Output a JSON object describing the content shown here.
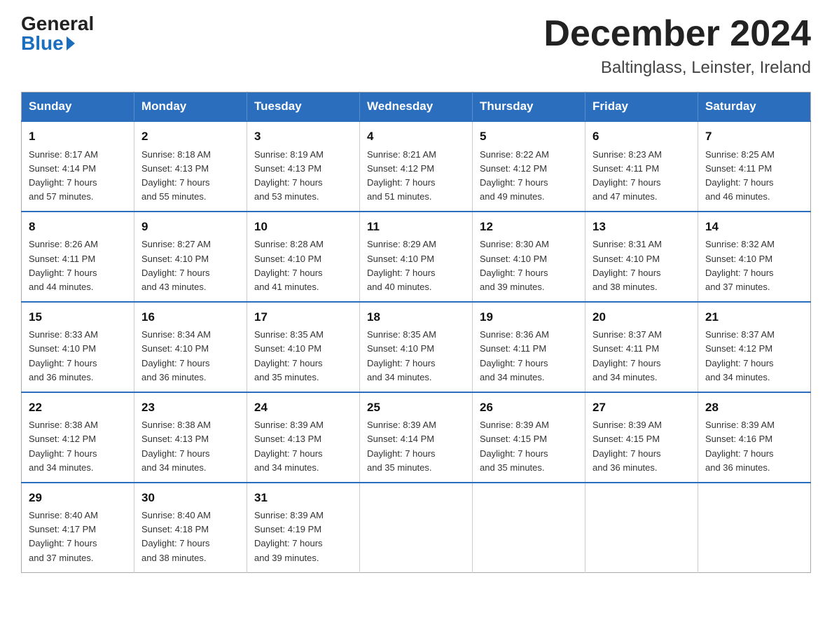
{
  "logo": {
    "general": "General",
    "blue": "Blue"
  },
  "title": {
    "month": "December 2024",
    "location": "Baltinglass, Leinster, Ireland"
  },
  "days_of_week": [
    "Sunday",
    "Monday",
    "Tuesday",
    "Wednesday",
    "Thursday",
    "Friday",
    "Saturday"
  ],
  "weeks": [
    [
      {
        "day": "1",
        "sunrise": "8:17 AM",
        "sunset": "4:14 PM",
        "daylight": "7 hours and 57 minutes."
      },
      {
        "day": "2",
        "sunrise": "8:18 AM",
        "sunset": "4:13 PM",
        "daylight": "7 hours and 55 minutes."
      },
      {
        "day": "3",
        "sunrise": "8:19 AM",
        "sunset": "4:13 PM",
        "daylight": "7 hours and 53 minutes."
      },
      {
        "day": "4",
        "sunrise": "8:21 AM",
        "sunset": "4:12 PM",
        "daylight": "7 hours and 51 minutes."
      },
      {
        "day": "5",
        "sunrise": "8:22 AM",
        "sunset": "4:12 PM",
        "daylight": "7 hours and 49 minutes."
      },
      {
        "day": "6",
        "sunrise": "8:23 AM",
        "sunset": "4:11 PM",
        "daylight": "7 hours and 47 minutes."
      },
      {
        "day": "7",
        "sunrise": "8:25 AM",
        "sunset": "4:11 PM",
        "daylight": "7 hours and 46 minutes."
      }
    ],
    [
      {
        "day": "8",
        "sunrise": "8:26 AM",
        "sunset": "4:11 PM",
        "daylight": "7 hours and 44 minutes."
      },
      {
        "day": "9",
        "sunrise": "8:27 AM",
        "sunset": "4:10 PM",
        "daylight": "7 hours and 43 minutes."
      },
      {
        "day": "10",
        "sunrise": "8:28 AM",
        "sunset": "4:10 PM",
        "daylight": "7 hours and 41 minutes."
      },
      {
        "day": "11",
        "sunrise": "8:29 AM",
        "sunset": "4:10 PM",
        "daylight": "7 hours and 40 minutes."
      },
      {
        "day": "12",
        "sunrise": "8:30 AM",
        "sunset": "4:10 PM",
        "daylight": "7 hours and 39 minutes."
      },
      {
        "day": "13",
        "sunrise": "8:31 AM",
        "sunset": "4:10 PM",
        "daylight": "7 hours and 38 minutes."
      },
      {
        "day": "14",
        "sunrise": "8:32 AM",
        "sunset": "4:10 PM",
        "daylight": "7 hours and 37 minutes."
      }
    ],
    [
      {
        "day": "15",
        "sunrise": "8:33 AM",
        "sunset": "4:10 PM",
        "daylight": "7 hours and 36 minutes."
      },
      {
        "day": "16",
        "sunrise": "8:34 AM",
        "sunset": "4:10 PM",
        "daylight": "7 hours and 36 minutes."
      },
      {
        "day": "17",
        "sunrise": "8:35 AM",
        "sunset": "4:10 PM",
        "daylight": "7 hours and 35 minutes."
      },
      {
        "day": "18",
        "sunrise": "8:35 AM",
        "sunset": "4:10 PM",
        "daylight": "7 hours and 34 minutes."
      },
      {
        "day": "19",
        "sunrise": "8:36 AM",
        "sunset": "4:11 PM",
        "daylight": "7 hours and 34 minutes."
      },
      {
        "day": "20",
        "sunrise": "8:37 AM",
        "sunset": "4:11 PM",
        "daylight": "7 hours and 34 minutes."
      },
      {
        "day": "21",
        "sunrise": "8:37 AM",
        "sunset": "4:12 PM",
        "daylight": "7 hours and 34 minutes."
      }
    ],
    [
      {
        "day": "22",
        "sunrise": "8:38 AM",
        "sunset": "4:12 PM",
        "daylight": "7 hours and 34 minutes."
      },
      {
        "day": "23",
        "sunrise": "8:38 AM",
        "sunset": "4:13 PM",
        "daylight": "7 hours and 34 minutes."
      },
      {
        "day": "24",
        "sunrise": "8:39 AM",
        "sunset": "4:13 PM",
        "daylight": "7 hours and 34 minutes."
      },
      {
        "day": "25",
        "sunrise": "8:39 AM",
        "sunset": "4:14 PM",
        "daylight": "7 hours and 35 minutes."
      },
      {
        "day": "26",
        "sunrise": "8:39 AM",
        "sunset": "4:15 PM",
        "daylight": "7 hours and 35 minutes."
      },
      {
        "day": "27",
        "sunrise": "8:39 AM",
        "sunset": "4:15 PM",
        "daylight": "7 hours and 36 minutes."
      },
      {
        "day": "28",
        "sunrise": "8:39 AM",
        "sunset": "4:16 PM",
        "daylight": "7 hours and 36 minutes."
      }
    ],
    [
      {
        "day": "29",
        "sunrise": "8:40 AM",
        "sunset": "4:17 PM",
        "daylight": "7 hours and 37 minutes."
      },
      {
        "day": "30",
        "sunrise": "8:40 AM",
        "sunset": "4:18 PM",
        "daylight": "7 hours and 38 minutes."
      },
      {
        "day": "31",
        "sunrise": "8:39 AM",
        "sunset": "4:19 PM",
        "daylight": "7 hours and 39 minutes."
      },
      null,
      null,
      null,
      null
    ]
  ]
}
